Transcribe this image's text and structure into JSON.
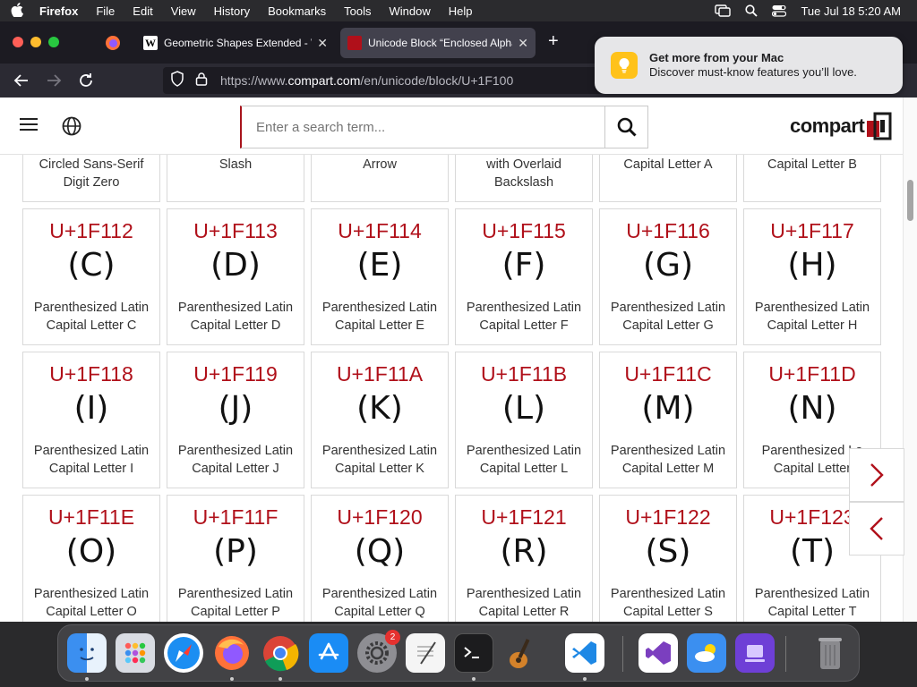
{
  "menubar": {
    "app": "Firefox",
    "items": [
      "File",
      "Edit",
      "View",
      "History",
      "Bookmarks",
      "Tools",
      "Window",
      "Help"
    ],
    "clock": "Tue Jul 18  5:20 AM"
  },
  "browser": {
    "tabs": [
      {
        "label": "Geometric Shapes Extended - W"
      },
      {
        "label": "Unicode Block “Enclosed Alphan"
      }
    ],
    "url_prefix": "https://www.",
    "url_domain": "compart.com",
    "url_path": "/en/unicode/block/U+1F100"
  },
  "notification": {
    "title": "Get more from your Mac",
    "body": "Discover must-know features you’ll love."
  },
  "site": {
    "search_placeholder": "Enter a search term...",
    "logo_text": "compart"
  },
  "top_partial": [
    {
      "line1": "Circled Sans-Serif",
      "line2": "Digit Zero"
    },
    {
      "line1": "Slash",
      "line2": ""
    },
    {
      "line1": "Arrow",
      "line2": ""
    },
    {
      "line1": "with Overlaid",
      "line2": "Backslash"
    },
    {
      "line1": "Capital Letter A",
      "line2": ""
    },
    {
      "line1": "Capital Letter B",
      "line2": ""
    }
  ],
  "cards": [
    {
      "code": "U+1F112",
      "glyph": "(C)",
      "line1": "Parenthesized Latin",
      "line2": "Capital Letter C"
    },
    {
      "code": "U+1F113",
      "glyph": "(D)",
      "line1": "Parenthesized Latin",
      "line2": "Capital Letter D"
    },
    {
      "code": "U+1F114",
      "glyph": "(E)",
      "line1": "Parenthesized Latin",
      "line2": "Capital Letter E"
    },
    {
      "code": "U+1F115",
      "glyph": "(F)",
      "line1": "Parenthesized Latin",
      "line2": "Capital Letter F"
    },
    {
      "code": "U+1F116",
      "glyph": "(G)",
      "line1": "Parenthesized Latin",
      "line2": "Capital Letter G"
    },
    {
      "code": "U+1F117",
      "glyph": "(H)",
      "line1": "Parenthesized Latin",
      "line2": "Capital Letter H"
    },
    {
      "code": "U+1F118",
      "glyph": "(I)",
      "line1": "Parenthesized Latin",
      "line2": "Capital Letter I"
    },
    {
      "code": "U+1F119",
      "glyph": "(J)",
      "line1": "Parenthesized Latin",
      "line2": "Capital Letter J"
    },
    {
      "code": "U+1F11A",
      "glyph": "(K)",
      "line1": "Parenthesized Latin",
      "line2": "Capital Letter K"
    },
    {
      "code": "U+1F11B",
      "glyph": "(L)",
      "line1": "Parenthesized Latin",
      "line2": "Capital Letter L"
    },
    {
      "code": "U+1F11C",
      "glyph": "(M)",
      "line1": "Parenthesized Latin",
      "line2": "Capital Letter M"
    },
    {
      "code": "U+1F11D",
      "glyph": "(N)",
      "line1": "Parenthesized La",
      "line2": "Capital Letter"
    },
    {
      "code": "U+1F11E",
      "glyph": "(O)",
      "line1": "Parenthesized Latin",
      "line2": "Capital Letter O"
    },
    {
      "code": "U+1F11F",
      "glyph": "(P)",
      "line1": "Parenthesized Latin",
      "line2": "Capital Letter P"
    },
    {
      "code": "U+1F120",
      "glyph": "(Q)",
      "line1": "Parenthesized Latin",
      "line2": "Capital Letter Q"
    },
    {
      "code": "U+1F121",
      "glyph": "(R)",
      "line1": "Parenthesized Latin",
      "line2": "Capital Letter R"
    },
    {
      "code": "U+1F122",
      "glyph": "(S)",
      "line1": "Parenthesized Latin",
      "line2": "Capital Letter S"
    },
    {
      "code": "U+1F123",
      "glyph": "(T)",
      "line1": "Parenthesized Latin",
      "line2": "Capital Letter T"
    }
  ],
  "dock": {
    "apps": [
      "finder-icon",
      "launchpad-icon",
      "safari-icon",
      "firefox-icon",
      "chrome-icon",
      "app-store-icon",
      "system-settings-icon",
      "textedit-icon",
      "terminal-icon",
      "garageband-icon",
      "vscode-icon",
      "visual-studio-icon",
      "weather-icon",
      "simulator-icon",
      "trash-icon"
    ],
    "settings_badge": "2"
  },
  "colors": {
    "accent_red": "#b0101a",
    "notification_icon": "#ffc21a"
  }
}
